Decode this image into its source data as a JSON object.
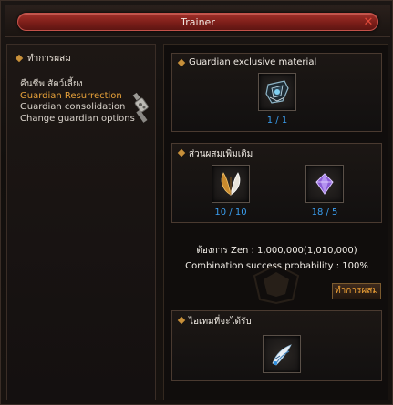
{
  "window": {
    "title": "Trainer"
  },
  "left_panel": {
    "header": "ทำการผสม",
    "menu": [
      {
        "label": "คืนชีพ สัตว์เลี้ยง",
        "active": false
      },
      {
        "label": "Guardian Resurrection",
        "active": true
      },
      {
        "label": "Guardian consolidation",
        "active": false
      },
      {
        "label": "Change guardian options",
        "active": false
      }
    ]
  },
  "exclusive_material": {
    "title": "Guardian exclusive material",
    "count": "1 / 1",
    "icon": "guardian-armor-icon"
  },
  "additional": {
    "title": "ส่วนผสมเพิ่มเติม",
    "items": [
      {
        "icon": "feather-wing-icon",
        "count": "10 / 10"
      },
      {
        "icon": "purple-gem-icon",
        "count": "18 / 5"
      }
    ]
  },
  "info": {
    "zen": "ต้องการ Zen : 1,000,000(1,010,000)",
    "probability": "Combination success probability : 100%"
  },
  "combine_button": "ทำการผสม",
  "result": {
    "title": "ไอเทมที่จะได้รับ",
    "icon": "guardian-wing-icon"
  },
  "colors": {
    "accent": "#e9a23a",
    "count_blue": "#3a9ef0",
    "title_red": "#8c2620"
  }
}
